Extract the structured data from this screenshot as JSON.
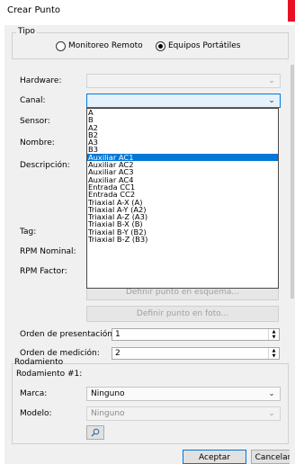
{
  "window": {
    "title": "Crear Punto"
  },
  "tipo": {
    "legend": "Tipo",
    "options": [
      {
        "label": "Monitoreo Remoto",
        "checked": false
      },
      {
        "label": "Equipos Portátiles",
        "checked": true
      }
    ]
  },
  "form": {
    "hardware_label": "Hardware:",
    "canal_label": "Canal:",
    "sensor_label": "Sensor:",
    "nombre_label": "Nombre:",
    "descripcion_label": "Descripción:",
    "tag_label": "Tag:",
    "rpm_nominal_label": "RPM Nominal:",
    "rpm_factor_label": "RPM Factor:"
  },
  "canal_dropdown": {
    "selected": "Auxiliar AC1",
    "options": [
      "A",
      "B",
      "A2",
      "B2",
      "A3",
      "B3",
      "Auxiliar AC1",
      "Auxiliar AC2",
      "Auxiliar AC3",
      "Auxiliar AC4",
      "Entrada CC1",
      "Entrada CC2",
      "Triaxial A-X (A)",
      "Triaxial A-Y (A2)",
      "Triaxial A-Z (A3)",
      "Triaxial B-X (B)",
      "Triaxial B-Y (B2)",
      "Triaxial B-Z (B3)"
    ]
  },
  "buttons": {
    "esquema": "Definir punto en esquema...",
    "foto": "Definir punto en foto...",
    "aceptar": "Aceptar",
    "cancelar": "Cancelar"
  },
  "orden": {
    "presentacion_label": "Orden de presentación:",
    "presentacion_value": "1",
    "medicion_label": "Orden de medición:",
    "medicion_value": "2"
  },
  "rodamiento": {
    "legend": "Rodamiento",
    "subtitle": "Rodamiento #1:",
    "marca_label": "Marca:",
    "marca_value": "Ninguno",
    "modelo_label": "Modelo:",
    "modelo_value": "Ninguno"
  },
  "icons": {
    "search": "search-icon",
    "chevron": "chevron-down-icon"
  },
  "colors": {
    "accent": "#0078d7",
    "close": "#e81123",
    "dialog_bg": "#f0f0f0"
  }
}
